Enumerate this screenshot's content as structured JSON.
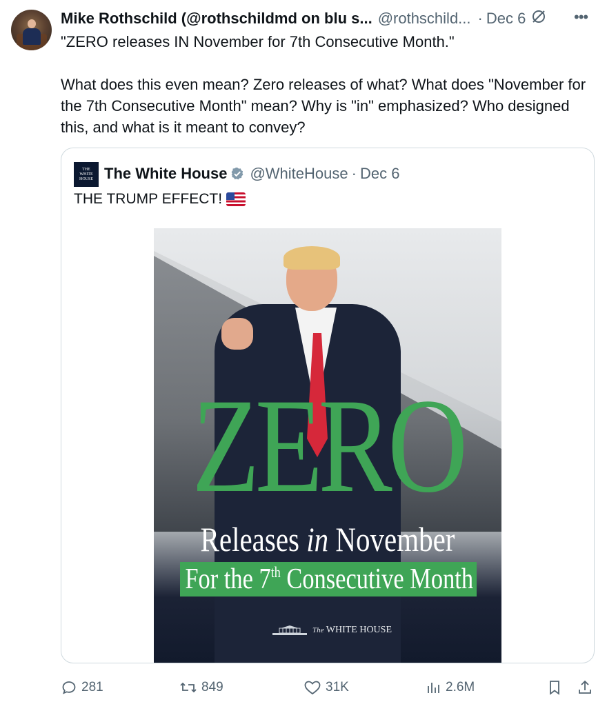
{
  "tweet": {
    "author_name": "Mike Rothschild (@rothschildmd on blu s...",
    "author_handle": "@rothschild...",
    "date": "Dec 6",
    "text_line1": "\"ZERO releases IN November for 7th Consecutive Month.\"",
    "text_para2": "What does this even mean? Zero releases of what? What does \"November for the 7th Consecutive Month\" mean? Why is \"in\" emphasized? Who designed this, and what is it meant to convey?"
  },
  "quote": {
    "avatar_text_1": "THE",
    "avatar_text_2": "WHITE",
    "avatar_text_3": "HOUSE",
    "author_name": "The White House",
    "author_handle": "@WhiteHouse",
    "date": "Dec 6",
    "text": "THE TRUMP EFFECT!",
    "poster": {
      "headline": "ZERO",
      "line_pre": "Releases ",
      "line_emph": "in",
      "line_post": " November",
      "banner_pre": "For the 7",
      "banner_sup": "th",
      "banner_post": " Consecutive Month",
      "brand_the": "The",
      "brand_name": "WHITE HOUSE",
      "colors": {
        "green": "#3fa556",
        "navy": "#121a2c"
      }
    }
  },
  "actions": {
    "replies": "281",
    "reposts": "849",
    "likes": "31K",
    "views": "2.6M"
  },
  "colors": {
    "secondary_text": "#536471",
    "border": "#cfd9de",
    "verified_gray": "#829aab"
  }
}
